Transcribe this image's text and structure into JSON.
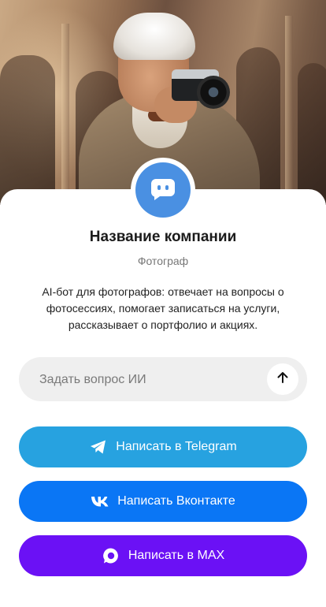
{
  "profile": {
    "company_name": "Название компании",
    "category": "Фотограф",
    "description": "AI-бот для фотографов: отвечает на вопросы о фотосессиях, помогает записаться на услуги, рассказывает о портфолио и акциях.",
    "avatar_icon": "chat-bubble-icon",
    "avatar_color": "#4a90e2"
  },
  "ask": {
    "placeholder": "Задать вопрос ИИ",
    "send_icon": "arrow-up-icon"
  },
  "actions": {
    "telegram": {
      "label": "Написать в Telegram",
      "icon": "telegram-icon",
      "color": "#27a2e0"
    },
    "vk": {
      "label": "Написать Вконтакте",
      "icon": "vk-icon",
      "color": "#0a76f5"
    },
    "max": {
      "label": "Написать в MAX",
      "icon": "max-icon",
      "color": "#6b11f5"
    }
  }
}
